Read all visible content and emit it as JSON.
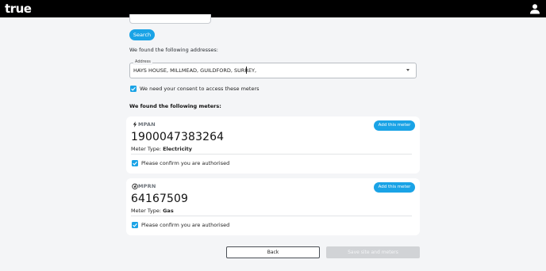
{
  "header": {
    "logo_text": "true",
    "user_icon": "user-icon",
    "background": "#000000"
  },
  "search": {
    "button_label": "Search"
  },
  "addresses": {
    "found_text": "We found the following addresses:",
    "field_label": "Address",
    "selected_value": "HAYS HOUSE, MILLMEAD, GUILDFORD, SURREY,"
  },
  "consent": {
    "checked": true,
    "label": "We need your consent to access these meters"
  },
  "meters_heading": "We found the following meters:",
  "meters": [
    {
      "kind": "MPAN",
      "icon": "lightning-icon",
      "add_label": "Add this meter",
      "number": "1900047383264",
      "type_label": "Meter Type:",
      "type_value": "Electricity",
      "authorised_checked": true,
      "authorised_label": "Please confirm you are authorised"
    },
    {
      "kind": "MPRN",
      "icon": "flame-icon",
      "add_label": "Add this meter",
      "number": "64167509",
      "type_label": "Meter Type:",
      "type_value": "Gas",
      "authorised_checked": true,
      "authorised_label": "Please confirm you are authorised"
    }
  ],
  "footer": {
    "back_label": "Back",
    "save_label": "Save site and meters",
    "save_disabled": true
  },
  "colors": {
    "accent": "#1aa3e6",
    "page_bg": "#f4f5f7",
    "disabled_bg": "#d1d3d6"
  }
}
